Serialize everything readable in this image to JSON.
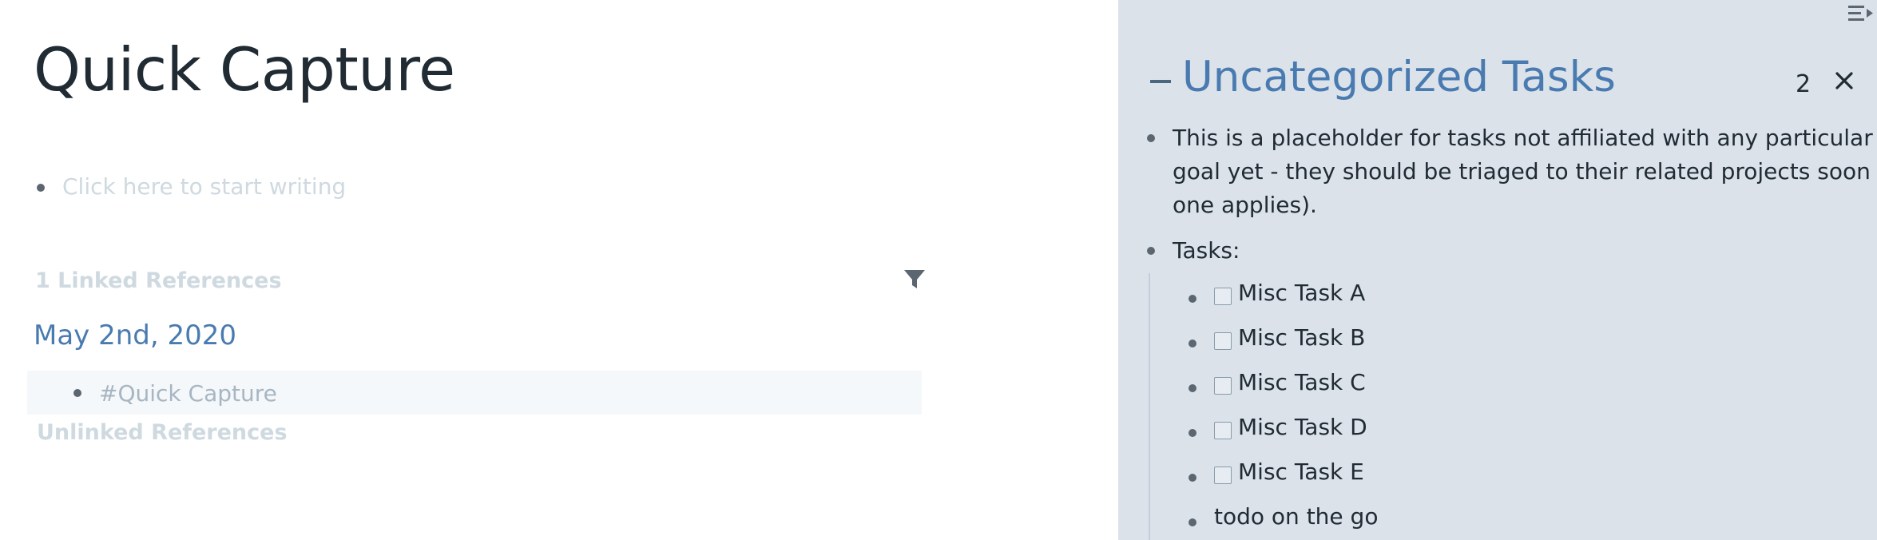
{
  "page": {
    "title": "Quick Capture",
    "placeholder": "Click here to start writing"
  },
  "references": {
    "linked_header": "1 Linked References",
    "date": "May 2nd, 2020",
    "block_text": "#Quick Capture",
    "unlinked_header": "Unlinked References"
  },
  "sidebar": {
    "title": "Uncategorized Tasks",
    "count": "2",
    "description_lines": [
      "This is a placeholder for tasks not affiliated with any particular",
      "goal yet - they should be triaged to their related projects soon (if",
      "one applies)."
    ],
    "tasks_label": "Tasks:",
    "tasks": [
      {
        "label": "Misc Task A",
        "checked": false
      },
      {
        "label": "Misc Task B",
        "checked": false
      },
      {
        "label": "Misc Task C",
        "checked": false
      },
      {
        "label": "Misc Task D",
        "checked": false
      },
      {
        "label": "Misc Task E",
        "checked": false
      }
    ],
    "extra_item": "todo on the go"
  },
  "icons": {
    "filter": "filter-icon",
    "close": "close-icon",
    "sidebar_toggle": "sidebar-toggle-icon",
    "collapse": "collapse-icon"
  },
  "colors": {
    "link_blue": "#4a7bb0",
    "sidebar_bg": "#dbe2ea",
    "muted_text": "#ced9e0"
  }
}
